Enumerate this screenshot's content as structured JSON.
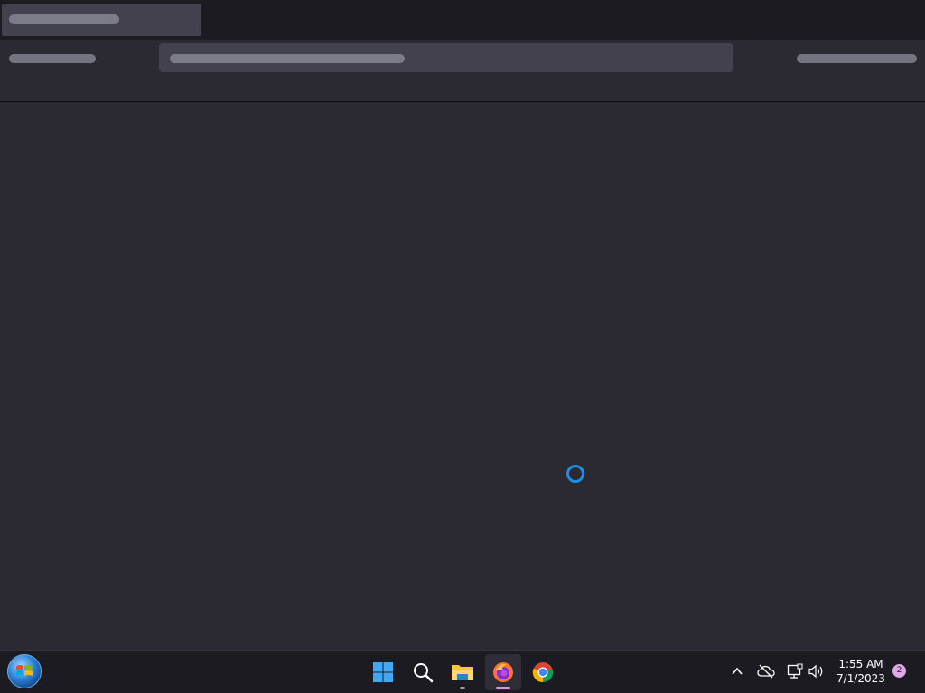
{
  "taskbar": {
    "apps": [
      {
        "name": "Start",
        "icon": "windows-start-icon"
      },
      {
        "name": "Search",
        "icon": "search-icon"
      },
      {
        "name": "File Explorer",
        "icon": "folder-icon",
        "running": true
      },
      {
        "name": "Firefox",
        "icon": "firefox-icon",
        "running": true,
        "focused": true
      },
      {
        "name": "Google Chrome",
        "icon": "chrome-icon"
      }
    ],
    "tray": {
      "time": "1:55 AM",
      "date": "7/1/2023",
      "notification_count": "2",
      "icons": [
        "chevron-up-icon",
        "cloud-offline-icon",
        "network-icon",
        "volume-icon"
      ]
    }
  },
  "colors": {
    "content_bg": "#2b2a33",
    "chrome_bg": "#1c1b22",
    "skeleton": "#42414d",
    "cursor": "#1a8fe8",
    "focused_indicator": "#e88ee8"
  }
}
